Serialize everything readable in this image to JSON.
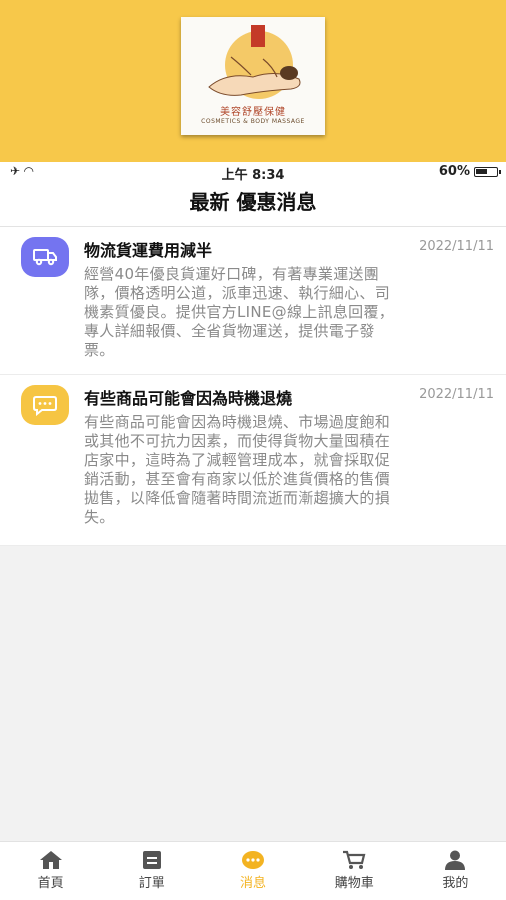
{
  "banner": {
    "logo_title": "美容舒壓保健",
    "logo_subtitle": "COSMETICS & BODY MASSAGE",
    "logo_seal": "美容之家"
  },
  "status_bar": {
    "time": "上午 8:34",
    "battery_text": "60%",
    "battery_level": 0.6
  },
  "page": {
    "title": "最新 優惠消息"
  },
  "messages": [
    {
      "icon": "truck-icon",
      "color": "#7474f0",
      "title": "物流貨運費用減半",
      "date": "2022/11/11",
      "lines": [
        "經營40年優良貨運好口碑，有著專業運送團",
        "隊，價格透明公道，派車迅速、執行細心、司",
        "機素質優良。提供官方LINE@線上訊息回覆，",
        "專人詳細報價、全省貨物運送，提供電子發",
        "票。"
      ]
    },
    {
      "icon": "chat-bubble-icon",
      "color": "#f6c543",
      "title": "有些商品可能會因為時機退燒",
      "date": "2022/11/11",
      "lines": [
        "有些商品可能會因為時機退燒、市場過度飽和",
        "或其他不可抗力因素，而使得貨物大量囤積在",
        "店家中，這時為了減輕管理成本，就會採取促",
        "銷活動，甚至會有商家以低於進貨價格的售價",
        "拋售，以降低會隨著時間流逝而漸趨擴大的損",
        "失。"
      ]
    }
  ],
  "tabbar": {
    "active_color": "#f3b322",
    "tabs": [
      {
        "icon": "home-icon",
        "label": "首頁"
      },
      {
        "icon": "order-icon",
        "label": "訂單"
      },
      {
        "icon": "message-icon",
        "label": "消息"
      },
      {
        "icon": "cart-icon",
        "label": "購物車"
      },
      {
        "icon": "user-icon",
        "label": "我的"
      }
    ]
  }
}
